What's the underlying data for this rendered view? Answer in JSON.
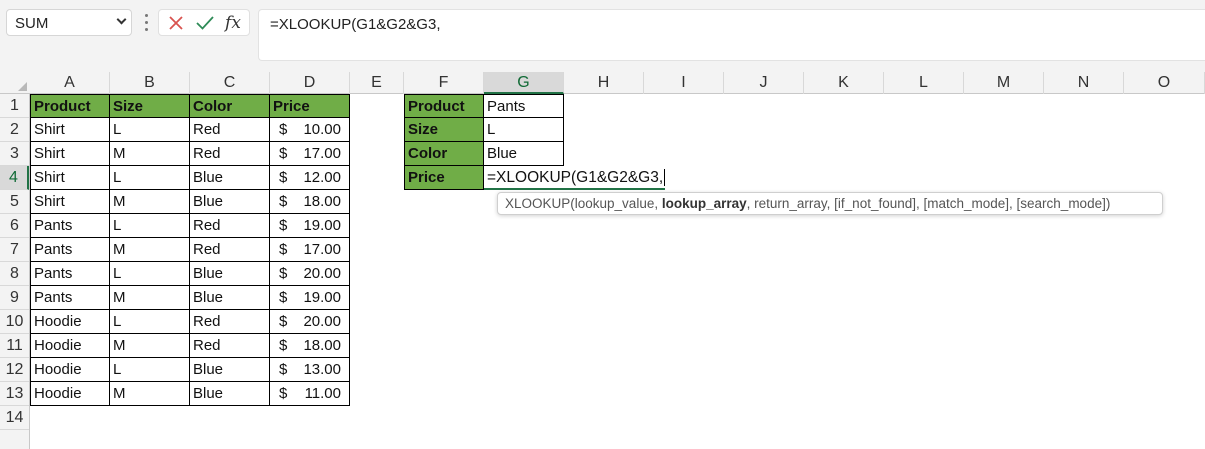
{
  "formula_bar": {
    "name_box": "SUM",
    "formula": "=XLOOKUP(G1&G2&G3,",
    "fx_label": "fx"
  },
  "columns": [
    "A",
    "B",
    "C",
    "D",
    "E",
    "F",
    "G",
    "H",
    "I",
    "J",
    "K",
    "L",
    "M",
    "N",
    "O"
  ],
  "rows": [
    "1",
    "2",
    "3",
    "4",
    "5",
    "6",
    "7",
    "8",
    "9",
    "10",
    "11",
    "12",
    "13",
    "14"
  ],
  "table": {
    "headers": [
      "Product",
      "Size",
      "Color",
      "Price"
    ],
    "rows": [
      [
        "Shirt",
        "L",
        "Red",
        "$",
        "10.00"
      ],
      [
        "Shirt",
        "M",
        "Red",
        "$",
        "17.00"
      ],
      [
        "Shirt",
        "L",
        "Blue",
        "$",
        "12.00"
      ],
      [
        "Shirt",
        "M",
        "Blue",
        "$",
        "18.00"
      ],
      [
        "Pants",
        "L",
        "Red",
        "$",
        "19.00"
      ],
      [
        "Pants",
        "M",
        "Red",
        "$",
        "17.00"
      ],
      [
        "Pants",
        "L",
        "Blue",
        "$",
        "20.00"
      ],
      [
        "Pants",
        "M",
        "Blue",
        "$",
        "19.00"
      ],
      [
        "Hoodie",
        "L",
        "Red",
        "$",
        "20.00"
      ],
      [
        "Hoodie",
        "M",
        "Red",
        "$",
        "18.00"
      ],
      [
        "Hoodie",
        "L",
        "Blue",
        "$",
        "13.00"
      ],
      [
        "Hoodie",
        "M",
        "Blue",
        "$",
        "11.00"
      ]
    ]
  },
  "lookup": {
    "labels": [
      "Product",
      "Size",
      "Color",
      "Price"
    ],
    "values": [
      "Pants",
      "L",
      "Blue"
    ],
    "editing": "=XLOOKUP(G1&G2&G3,"
  },
  "tooltip": {
    "prefix": "XLOOKUP(lookup_value, ",
    "bold": "lookup_array",
    "suffix": ", return_array, [if_not_found], [match_mode], [search_mode])"
  },
  "colors": {
    "header_green": "#70ad47",
    "active_green": "#217346",
    "cancel_red": "#d9534f",
    "confirm_green": "#2e8b57"
  },
  "active_cell": "G4"
}
